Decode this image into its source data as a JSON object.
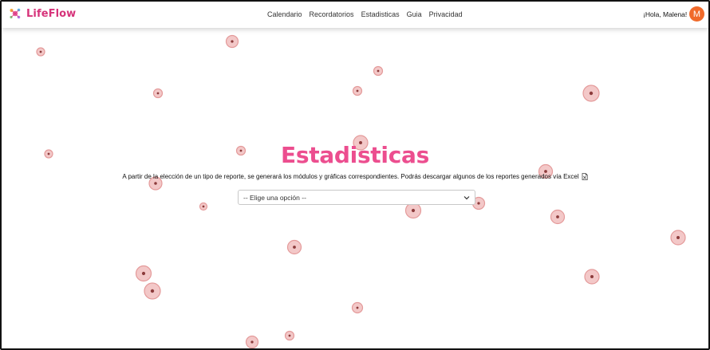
{
  "header": {
    "brand": "LifeFlow",
    "nav": [
      "Calendario",
      "Recordatorios",
      "Estadisticas",
      "Guia",
      "Privacidad"
    ],
    "greeting": "¡Hola, Malena!",
    "avatar_initial": "M"
  },
  "main": {
    "title": "Estadisticas",
    "subtitle": "A partir de la elección de un tipo de reporte, se generará los módulos y gráficas correspondientes. Podrás descargar algunos de los reportes generados vía Excel",
    "subtitle_icon": "excel-file-icon",
    "select": {
      "selected": "-- Elige una opción --"
    }
  },
  "colors": {
    "brand": "#d6337a",
    "title": "#ec4e8f",
    "avatar": "#f06a2a",
    "bubble_fill": "#f3c8c8",
    "bubble_stroke": "#e49a9a",
    "bubble_core": "#8c3b3b"
  }
}
